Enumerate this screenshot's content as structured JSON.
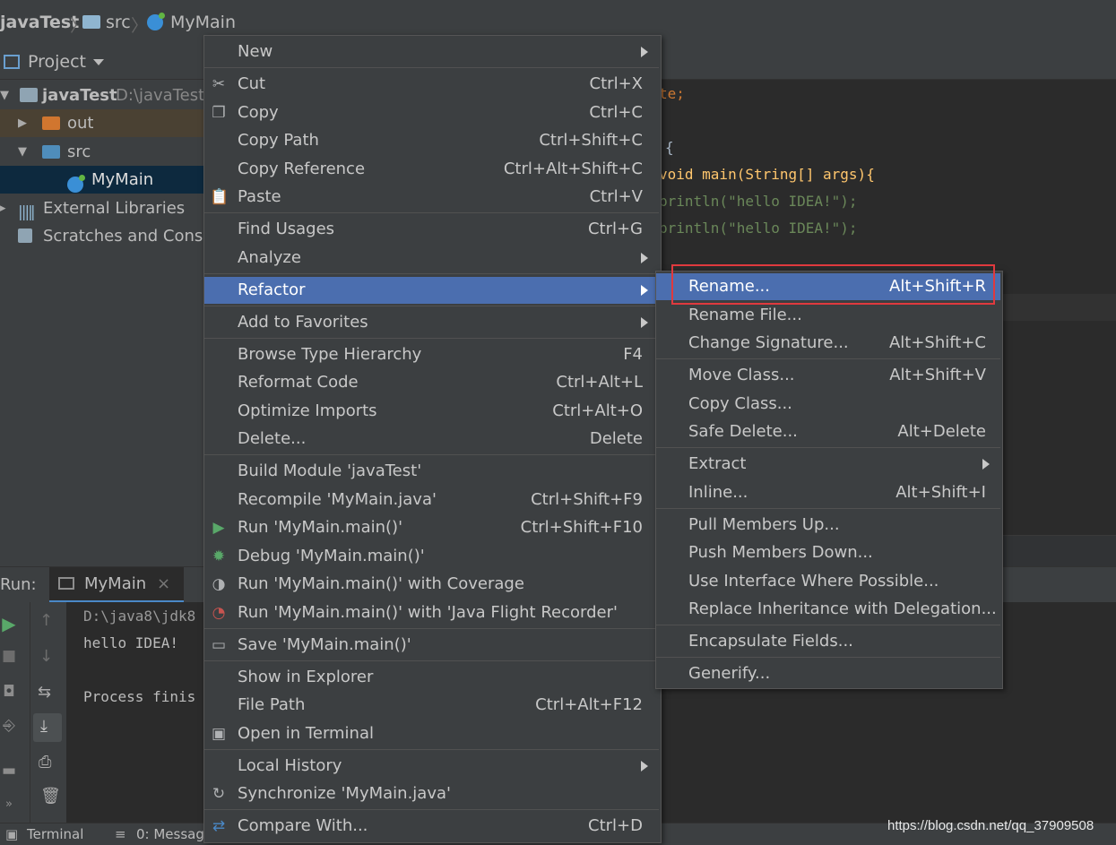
{
  "breadcrumb": {
    "project": "javaTest",
    "folder": "src",
    "file": "MyMain"
  },
  "project_panel": {
    "title": "Project",
    "tree": [
      {
        "label": "javaTest",
        "path": "D:\\javaTest",
        "icon": "module-folder-icon"
      },
      {
        "label": "out",
        "icon": "folder-orange-icon"
      },
      {
        "label": "src",
        "icon": "folder-blue-icon"
      },
      {
        "label": "MyMain",
        "icon": "class-icon"
      },
      {
        "label": "External Libraries",
        "icon": "libraries-icon"
      },
      {
        "label": "Scratches and Conso",
        "icon": "scratches-icon"
      }
    ]
  },
  "editor": {
    "lines": [
      "te;",
      "{",
      "void main(String[] args){",
      "println(\"hello IDEA!\");",
      "println(\"hello IDEA!\");"
    ]
  },
  "run_panel": {
    "label": "Run:",
    "tab": "MyMain",
    "output": [
      "D:\\java8\\jdk8",
      "hello IDEA!",
      "Process finis"
    ]
  },
  "statusbar": {
    "terminal": "Terminal",
    "messages": "0: Messag",
    "watermark": "https://blog.csdn.net/qq_37909508"
  },
  "context_menu": [
    {
      "label": "New",
      "shortcut": "",
      "submenu": true
    },
    {
      "label": "Cut",
      "shortcut": "Ctrl+X",
      "icon": "scissors-icon"
    },
    {
      "label": "Copy",
      "shortcut": "Ctrl+C",
      "icon": "copy-icon"
    },
    {
      "label": "Copy Path",
      "shortcut": "Ctrl+Shift+C"
    },
    {
      "label": "Copy Reference",
      "shortcut": "Ctrl+Alt+Shift+C"
    },
    {
      "label": "Paste",
      "shortcut": "Ctrl+V",
      "icon": "clipboard-icon"
    },
    {
      "label": "Find Usages",
      "shortcut": "Ctrl+G"
    },
    {
      "label": "Analyze",
      "shortcut": "",
      "submenu": true
    },
    {
      "label": "Refactor",
      "shortcut": "",
      "submenu": true,
      "selected": true
    },
    {
      "label": "Add to Favorites",
      "shortcut": "",
      "submenu": true
    },
    {
      "label": "Browse Type Hierarchy",
      "shortcut": "F4"
    },
    {
      "label": "Reformat Code",
      "shortcut": "Ctrl+Alt+L"
    },
    {
      "label": "Optimize Imports",
      "shortcut": "Ctrl+Alt+O"
    },
    {
      "label": "Delete...",
      "shortcut": "Delete"
    },
    {
      "label": "Build Module 'javaTest'",
      "shortcut": ""
    },
    {
      "label": "Recompile 'MyMain.java'",
      "shortcut": "Ctrl+Shift+F9"
    },
    {
      "label": "Run 'MyMain.main()'",
      "shortcut": "Ctrl+Shift+F10",
      "icon": "run-icon"
    },
    {
      "label": "Debug 'MyMain.main()'",
      "shortcut": "",
      "icon": "debug-icon"
    },
    {
      "label": "Run 'MyMain.main()' with Coverage",
      "shortcut": "",
      "icon": "coverage-icon"
    },
    {
      "label": "Run 'MyMain.main()' with 'Java Flight Recorder'",
      "shortcut": "",
      "icon": "profiler-icon"
    },
    {
      "label": "Save 'MyMain.main()'",
      "shortcut": "",
      "icon": "save-config-icon"
    },
    {
      "label": "Show in Explorer",
      "shortcut": ""
    },
    {
      "label": "File Path",
      "shortcut": "Ctrl+Alt+F12"
    },
    {
      "label": "Open in Terminal",
      "shortcut": "",
      "icon": "terminal-icon"
    },
    {
      "label": "Local History",
      "shortcut": "",
      "submenu": true
    },
    {
      "label": "Synchronize 'MyMain.java'",
      "shortcut": "",
      "icon": "sync-icon"
    },
    {
      "label": "Compare With...",
      "shortcut": "Ctrl+D",
      "icon": "compare-icon"
    }
  ],
  "refactor_submenu": [
    {
      "label": "Rename...",
      "shortcut": "Alt+Shift+R",
      "selected": true
    },
    {
      "label": "Rename File...",
      "shortcut": ""
    },
    {
      "label": "Change Signature...",
      "shortcut": "Alt+Shift+C"
    },
    {
      "label": "Move Class...",
      "shortcut": "Alt+Shift+V"
    },
    {
      "label": "Copy Class...",
      "shortcut": ""
    },
    {
      "label": "Safe Delete...",
      "shortcut": "Alt+Delete"
    },
    {
      "label": "Extract",
      "shortcut": "",
      "submenu": true
    },
    {
      "label": "Inline...",
      "shortcut": "Alt+Shift+I"
    },
    {
      "label": "Pull Members Up...",
      "shortcut": ""
    },
    {
      "label": "Push Members Down...",
      "shortcut": ""
    },
    {
      "label": "Use Interface Where Possible...",
      "shortcut": ""
    },
    {
      "label": "Replace Inheritance with Delegation...",
      "shortcut": ""
    },
    {
      "label": "Encapsulate Fields...",
      "shortcut": ""
    },
    {
      "label": "Generify...",
      "shortcut": ""
    }
  ],
  "colors": {
    "selection": "#4b6eaf",
    "highlight_box": "#e0393e",
    "menu_bg": "#3c3f41"
  }
}
